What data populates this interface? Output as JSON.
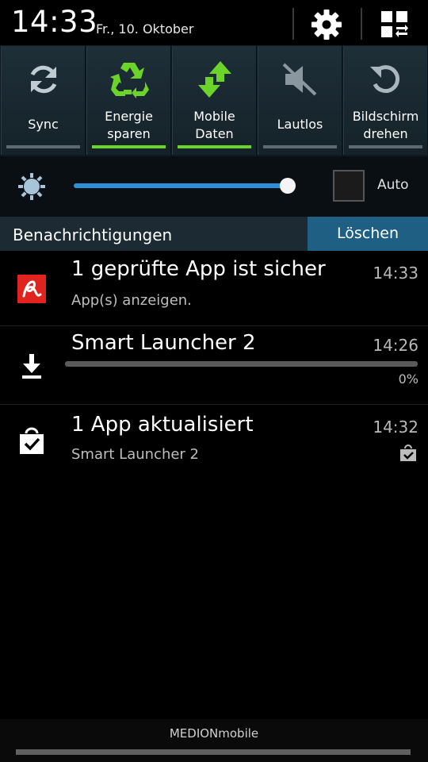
{
  "header": {
    "time": "14:33",
    "date": "Fr., 10. Oktober",
    "settings_icon": "gear-icon",
    "grid_icon": "grid-toggle-icon"
  },
  "toggles": [
    {
      "label": "Sync",
      "icon": "sync-icon",
      "active": false
    },
    {
      "label": "Energie sparen",
      "line1": "Energie",
      "line2": "sparen",
      "icon": "recycle-icon",
      "active": true
    },
    {
      "label": "Mobile Daten",
      "line1": "Mobile",
      "line2": "Daten",
      "icon": "mobile-data-icon",
      "active": true
    },
    {
      "label": "Lautlos",
      "icon": "mute-icon",
      "active": false
    },
    {
      "label": "Bildschirm drehen",
      "line1": "Bildschirm",
      "line2": "drehen",
      "icon": "rotate-icon",
      "active": false
    }
  ],
  "brightness": {
    "level_fraction": 1.0,
    "auto_label": "Auto",
    "auto_checked": false
  },
  "notifications_header": {
    "title": "Benachrichtigungen",
    "clear_label": "Löschen"
  },
  "notifications": [
    {
      "title": "1 geprüfte App ist sicher",
      "subtitle": "App(s) anzeigen.",
      "time": "14:33",
      "icon": "avira-icon"
    },
    {
      "title": "Smart Launcher 2",
      "time": "14:26",
      "progress_percent": 0,
      "progress_label": "0%",
      "icon": "download-icon"
    },
    {
      "title": "1 App aktualisiert",
      "subtitle": "Smart Launcher 2",
      "time": "14:32",
      "icon": "shopping-bag-check-icon"
    }
  ],
  "footer": {
    "carrier": "MEDIONmobile"
  },
  "colors": {
    "accent_blue": "#2d8fd6",
    "toggle_on_green": "#6cd32a",
    "clear_button": "#1e5f83",
    "avira_red": "#e0231e"
  }
}
